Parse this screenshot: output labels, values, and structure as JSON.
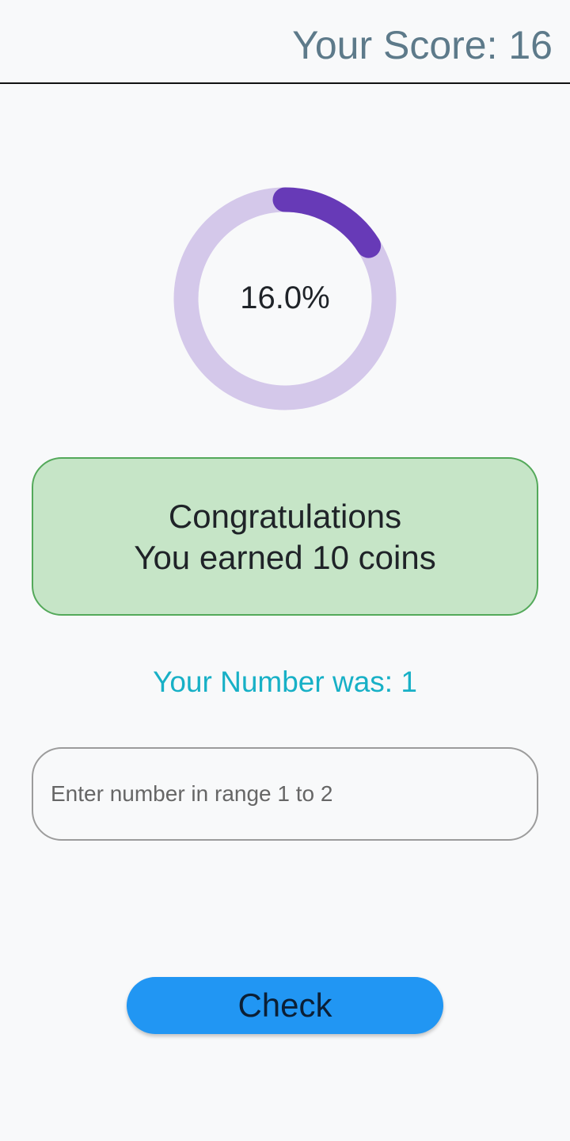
{
  "header": {
    "score_text": "Your Score: 16"
  },
  "progress": {
    "percent_text": "16.0%",
    "value_fraction": 0.16,
    "track_color": "#d4c8ea",
    "fill_color": "#673ab7"
  },
  "result": {
    "line1": "Congratulations",
    "line2": "You earned 10 coins",
    "bg_color": "#c6e5c7",
    "border_color": "#54a95a"
  },
  "number_info": {
    "text": "Your Number was: 1",
    "color": "#17b0c6"
  },
  "input": {
    "value": "",
    "placeholder": "Enter number in range 1 to 2"
  },
  "actions": {
    "check_label": "Check",
    "button_color": "#2196f3"
  }
}
